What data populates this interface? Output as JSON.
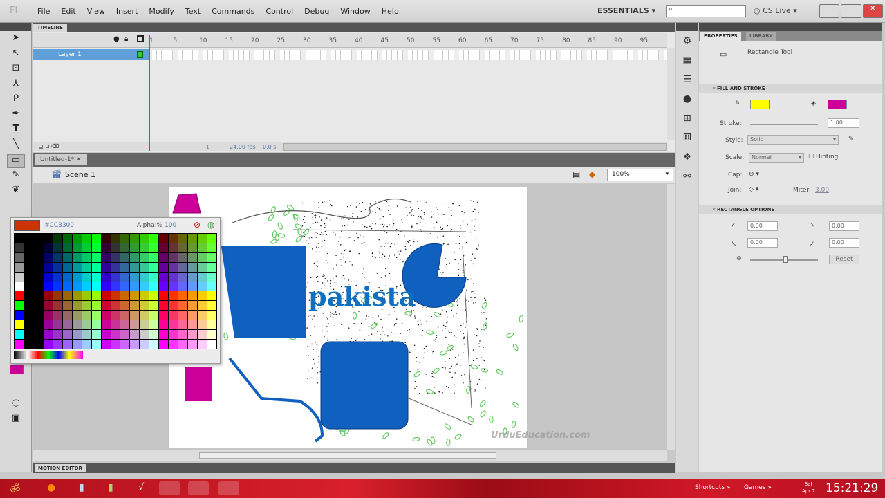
{
  "app": {
    "logo": "Fl",
    "workspace": "ESSENTIALS",
    "cs_live": "CS Live"
  },
  "menu": [
    "File",
    "Edit",
    "View",
    "Insert",
    "Modify",
    "Text",
    "Commands",
    "Control",
    "Debug",
    "Window",
    "Help"
  ],
  "timeline": {
    "tab": "TIMELINE",
    "frame_numbers": [
      "1",
      "5",
      "10",
      "15",
      "20",
      "25",
      "30",
      "35",
      "40",
      "45",
      "50",
      "55",
      "60",
      "65",
      "70",
      "75",
      "80",
      "85",
      "90",
      "95"
    ],
    "layer": "Layer 1",
    "current_frame": "1",
    "fps": "24.00 fps",
    "time": "0.0 s"
  },
  "document": {
    "tab": "Untitled-1*",
    "scene": "Scene 1",
    "zoom": "100%",
    "stage_text": "pakista",
    "watermark": "UrduEducation.com"
  },
  "color_picker": {
    "current_color": "#CC3300",
    "hex": "#CC3300",
    "alpha_label": "Alpha:%",
    "alpha": "100"
  },
  "motion_editor": "MOTION EDITOR",
  "properties": {
    "tabs": [
      "PROPERTIES",
      "LIBRARY"
    ],
    "tool": "Rectangle Tool",
    "fill_stroke": "FILL AND STROKE",
    "stroke_color": "#FFFF00",
    "fill_color": "#CC0099",
    "stroke_label": "Stroke:",
    "stroke_value": "1.00",
    "style_label": "Style:",
    "style_value": "Solid",
    "scale_label": "Scale:",
    "scale_value": "Normal",
    "hinting": "Hinting",
    "cap_label": "Cap:",
    "join_label": "Join:",
    "miter_label": "Miter:",
    "miter_value": "3.00",
    "rect_options": "RECTANGLE OPTIONS",
    "corners": [
      "0.00",
      "0.00",
      "0.00",
      "0.00"
    ],
    "reset": "Reset"
  },
  "taskbar": {
    "shortcuts": "Shortcuts",
    "games": "Games",
    "day": "Sat",
    "date": "Apr 7",
    "time": "15:21:29"
  }
}
